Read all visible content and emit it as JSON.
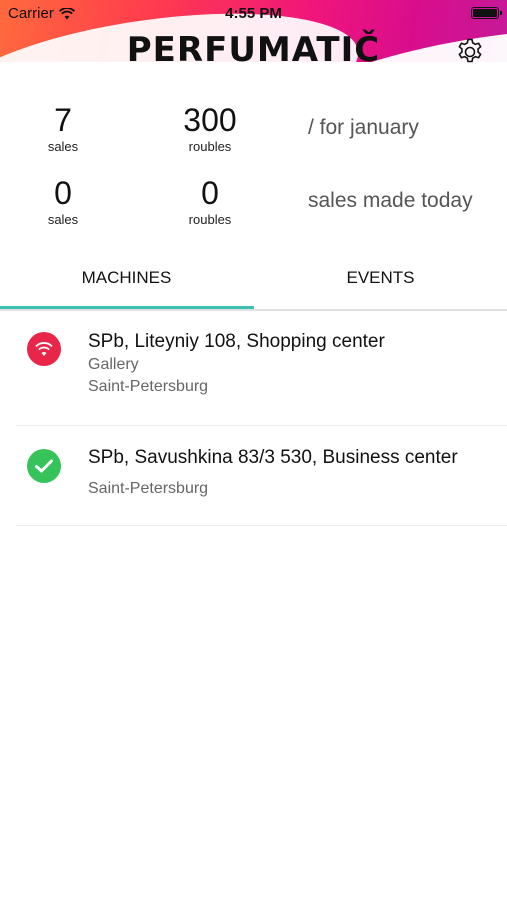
{
  "status_bar": {
    "carrier": "Carrier",
    "time": "4:55 PM"
  },
  "app": {
    "logo": "PERFUMATIČ"
  },
  "stats": {
    "month": {
      "sales": "7",
      "sales_unit": "sales",
      "roubles": "300",
      "roubles_unit": "roubles",
      "note": "/ for january"
    },
    "today": {
      "sales": "0",
      "sales_unit": "sales",
      "roubles": "0",
      "roubles_unit": "roubles",
      "note": "sales made today"
    }
  },
  "tabs": [
    {
      "label": "MACHINES",
      "active": true
    },
    {
      "label": "EVENTS",
      "active": false
    }
  ],
  "machines": [
    {
      "title": "SPb, Liteyniy 108, Shopping center",
      "place": "Gallery",
      "city": "Saint-Petersburg",
      "status_icon": "wifi-off-icon",
      "status_color": "#e8264a"
    },
    {
      "title": "SPb, Savushkina 83/3 530, Business center",
      "city": "Saint-Petersburg",
      "status_icon": "check-icon",
      "status_color": "#35c35a"
    }
  ]
}
